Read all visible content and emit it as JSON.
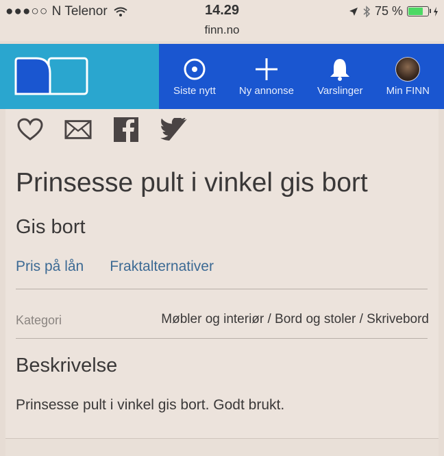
{
  "status_bar": {
    "signal": "●●●○○",
    "carrier": "N Telenor",
    "time": "14.29",
    "url": "finn.no",
    "battery_text": "75 %",
    "battery_level": 0.75,
    "icons": [
      "wifi-icon",
      "location-arrow-icon",
      "bluetooth-icon",
      "battery-icon",
      "charging-icon"
    ]
  },
  "nav": {
    "logo_icon": "finn-logo-icon",
    "items": [
      {
        "label": "Siste nytt",
        "icon": "target-icon"
      },
      {
        "label": "Ny annonse",
        "icon": "plus-icon"
      },
      {
        "label": "Varslinger",
        "icon": "bell-icon"
      },
      {
        "label": "Min FINN",
        "icon": "avatar"
      }
    ],
    "colors": {
      "logo_bg": "#2aa6cf",
      "menu_bg": "#1a56d0"
    }
  },
  "share": {
    "icons": [
      "heart-icon",
      "mail-icon",
      "facebook-icon",
      "twitter-icon"
    ]
  },
  "ad": {
    "title": "Prinsesse pult i vinkel gis bort",
    "price": "Gis bort",
    "links": [
      "Pris på lån",
      "Fraktalternativer"
    ],
    "category_label": "Kategori",
    "category_value": "Møbler og interiør / Bord og stoler / Skrivebord",
    "description_heading": "Beskrivelse",
    "description_text": "Prinsesse pult i vinkel gis bort. Godt brukt."
  }
}
